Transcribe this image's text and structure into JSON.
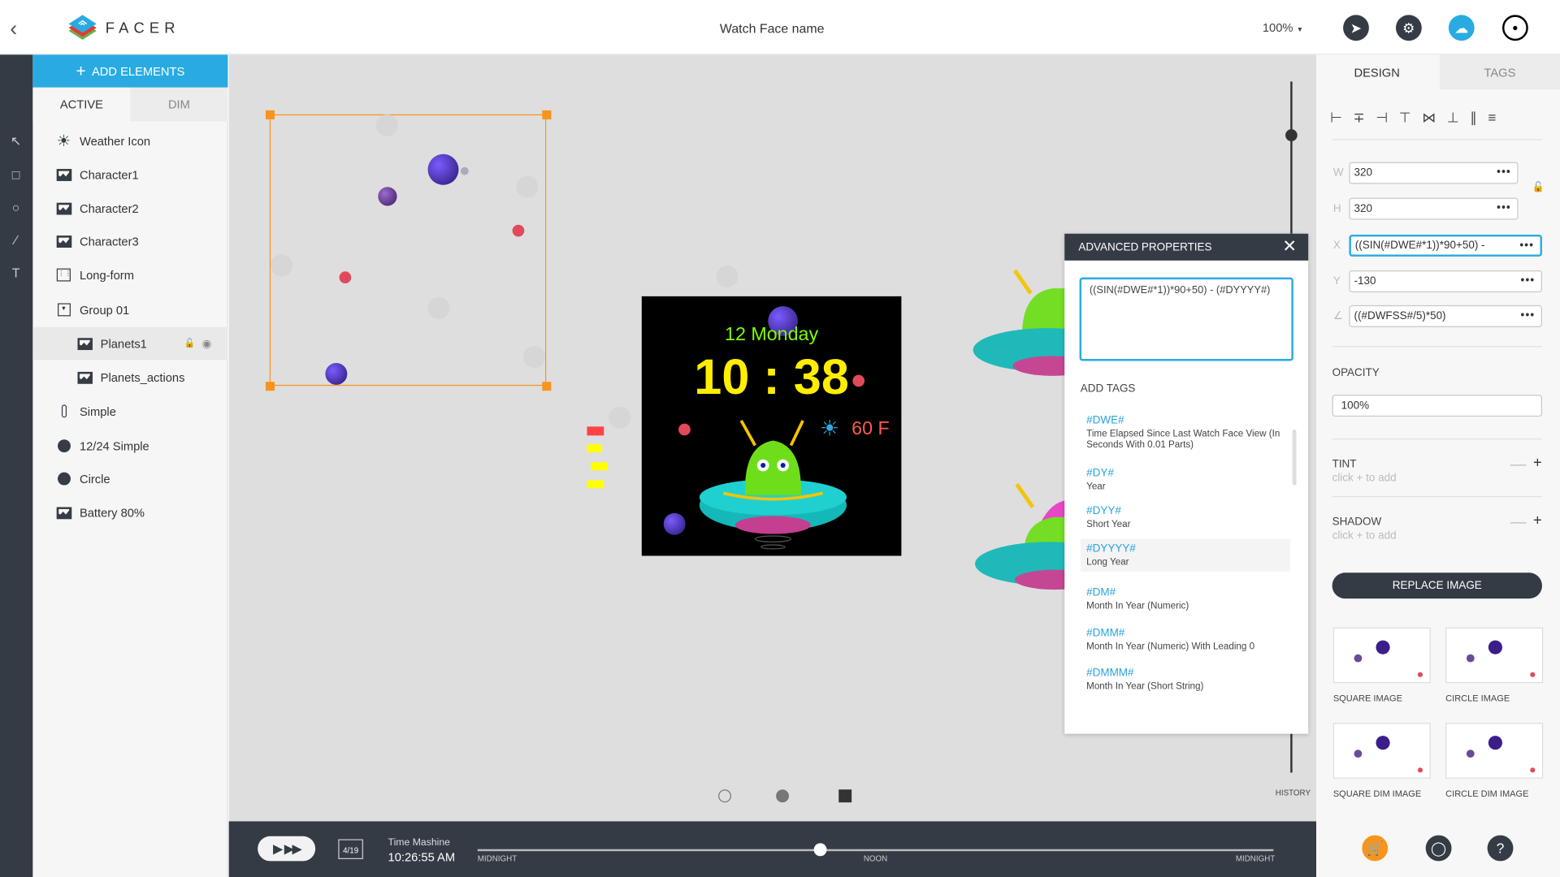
{
  "header": {
    "title": "Watch Face name",
    "zoom": "100%",
    "brand": "FACER",
    "icons": [
      "back-icon",
      "share-icon",
      "settings-icon",
      "cloud-upload-icon",
      "avatar"
    ]
  },
  "layers": {
    "add_label": "ADD ELEMENTS",
    "tabs": [
      "ACTIVE",
      "DIM"
    ],
    "items": [
      {
        "label": "Weather Icon",
        "icon": "sun-icon"
      },
      {
        "label": "Character1",
        "icon": "image-icon"
      },
      {
        "label": "Character2",
        "icon": "image-icon"
      },
      {
        "label": "Character3",
        "icon": "image-icon"
      },
      {
        "label": "Long-form",
        "icon": "calendar-icon"
      },
      {
        "label": "Group 01",
        "icon": "group-icon"
      },
      {
        "label": "Planets1",
        "icon": "image-icon",
        "selected": true
      },
      {
        "label": "Planets_actions",
        "icon": "image-icon"
      },
      {
        "label": "Simple",
        "icon": "thermometer-icon"
      },
      {
        "label": "12/24 Simple",
        "icon": "circle-icon"
      },
      {
        "label": "Circle",
        "icon": "circle-icon"
      },
      {
        "label": "Battery 80%",
        "icon": "image-icon"
      }
    ]
  },
  "watch": {
    "date": "12 Monday",
    "time": "10 : 38",
    "temp": "60 F"
  },
  "canvas": {
    "history": "HISTORY"
  },
  "advanced": {
    "title": "ADVANCED PROPERTIES",
    "expression": "((SIN(#DWE#*1))*90+50) - (#DYYYY#)",
    "add_tags": "ADD TAGS",
    "tags": [
      {
        "code": "#DWE#",
        "desc": "Time Elapsed Since Last Watch Face View (In Seconds With 0.01 Parts)"
      },
      {
        "code": "#DY#",
        "desc": "Year"
      },
      {
        "code": "#DYY#",
        "desc": "Short Year"
      },
      {
        "code": "#DYYYY#",
        "desc": "Long Year"
      },
      {
        "code": "#DM#",
        "desc": "Month In Year (Numeric)"
      },
      {
        "code": "#DMM#",
        "desc": "Month In Year (Numeric) With Leading 0"
      },
      {
        "code": "#DMMM#",
        "desc": "Month In Year (Short String)"
      }
    ]
  },
  "bottom": {
    "date": "4/19",
    "label": "Time Mashine",
    "time": "10:26:55 AM",
    "ticks": [
      "MIDNIGHT",
      "NOON",
      "MIDNIGHT"
    ],
    "progress": 0.43
  },
  "right": {
    "tabs": [
      "DESIGN",
      "TAGS"
    ],
    "fields": {
      "w": {
        "label": "W",
        "value": "320"
      },
      "h": {
        "label": "H",
        "value": "320"
      },
      "x": {
        "label": "X",
        "value": "((SIN(#DWE#*1))*90+50) -"
      },
      "y": {
        "label": "Y",
        "value": "-130"
      },
      "r": {
        "value": "((#DWFSS#/5)*50)"
      }
    },
    "opacity_label": "OPACITY",
    "opacity": "100%",
    "tint": "TINT",
    "shadow": "SHADOW",
    "hint": "click + to add",
    "replace": "REPLACE IMAGE",
    "thumbs": [
      "SQUARE IMAGE",
      "CIRCLE IMAGE",
      "SQUARE DIM IMAGE",
      "CIRCLE DIM IMAGE"
    ]
  },
  "colors": {
    "accent": "#29abe2",
    "dark": "#343b44",
    "selection": "#f7941d",
    "time": "#ffee00",
    "date": "#7cff00",
    "temp": "#ff5a4a"
  }
}
